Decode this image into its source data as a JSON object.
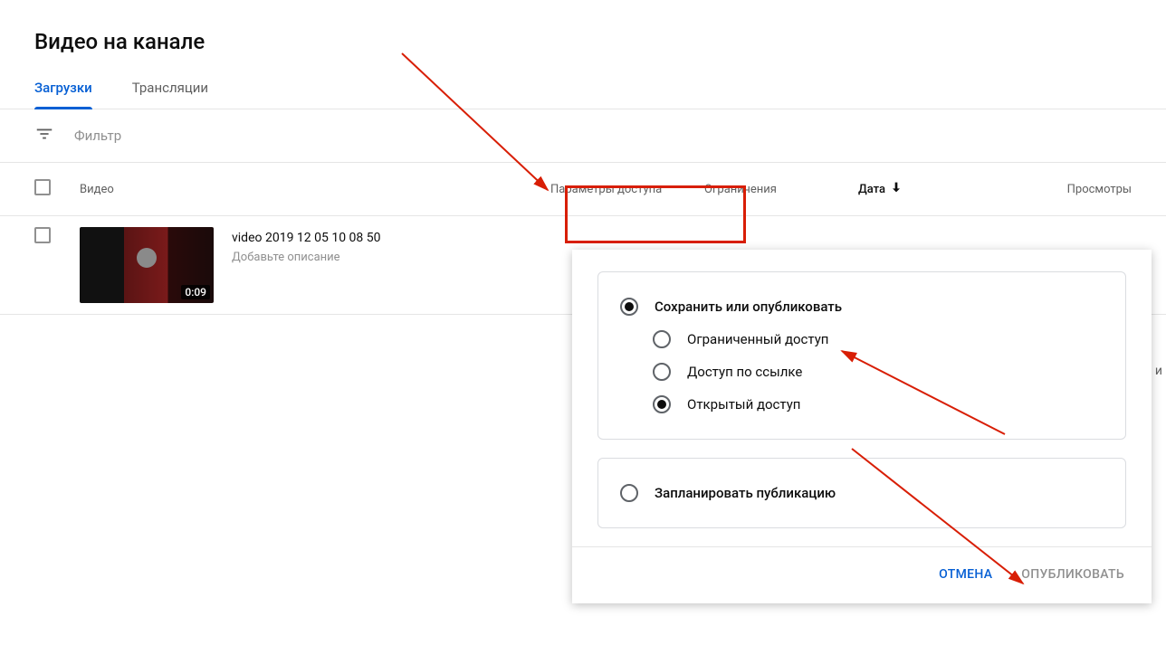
{
  "page": {
    "title": "Видео на канале"
  },
  "tabs": {
    "uploads": "Загрузки",
    "live": "Трансляции"
  },
  "filter": {
    "label": "Фильтр"
  },
  "columns": {
    "video": "Видео",
    "access": "Параметры доступа",
    "restrictions": "Ограничения",
    "date": "Дата",
    "views": "Просмотры"
  },
  "row": {
    "title": "video 2019 12 05 10 08 50",
    "desc": "Добавьте описание",
    "duration": "0:09"
  },
  "popup": {
    "save_or_publish": "Сохранить или опубликовать",
    "options": {
      "private": "Ограниченный доступ",
      "unlisted": "Доступ по ссылке",
      "public": "Открытый доступ"
    },
    "schedule": "Запланировать публикацию",
    "cancel": "ОТМЕНА",
    "publish": "ОПУБЛИКОВАТЬ"
  },
  "truncated": "и"
}
